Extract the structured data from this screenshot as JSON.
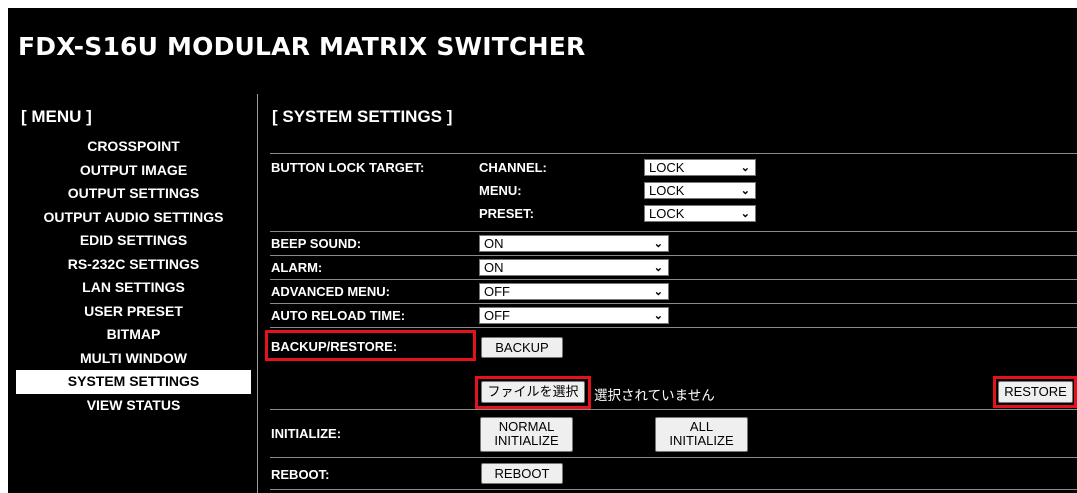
{
  "app": {
    "title": "FDX-S16U MODULAR MATRIX SWITCHER"
  },
  "menu": {
    "heading": "[ MENU ]",
    "items": [
      {
        "label": "CROSSPOINT"
      },
      {
        "label": "OUTPUT IMAGE"
      },
      {
        "label": "OUTPUT SETTINGS"
      },
      {
        "label": "OUTPUT AUDIO SETTINGS"
      },
      {
        "label": "EDID SETTINGS"
      },
      {
        "label": "RS-232C SETTINGS"
      },
      {
        "label": "LAN SETTINGS"
      },
      {
        "label": "USER PRESET"
      },
      {
        "label": "BITMAP"
      },
      {
        "label": "MULTI WINDOW"
      },
      {
        "label": "SYSTEM SETTINGS",
        "active": true
      },
      {
        "label": "VIEW STATUS"
      }
    ]
  },
  "main": {
    "heading": "[ SYSTEM SETTINGS ]",
    "button_lock": {
      "label": "BUTTON LOCK TARGET:",
      "channel_label": "CHANNEL:",
      "channel_value": "LOCK",
      "menu_label": "MENU:",
      "menu_value": "LOCK",
      "preset_label": "PRESET:",
      "preset_value": "LOCK"
    },
    "beep_sound": {
      "label": "BEEP SOUND:",
      "value": "ON"
    },
    "alarm": {
      "label": "ALARM:",
      "value": "ON"
    },
    "advanced_menu": {
      "label": "ADVANCED MENU:",
      "value": "OFF"
    },
    "auto_reload_time": {
      "label": "AUTO RELOAD TIME:",
      "value": "OFF"
    },
    "backup_restore": {
      "label": "BACKUP/RESTORE:",
      "backup_button": "BACKUP",
      "file_button": "ファイルを選択",
      "file_status": "選択されていません",
      "restore_button": "RESTORE"
    },
    "initialize": {
      "label": "INITIALIZE:",
      "normal_line1": "NORMAL",
      "normal_line2": "INITIALIZE",
      "all_line1": "ALL",
      "all_line2": "INITIALIZE"
    },
    "reboot": {
      "label": "REBOOT:",
      "button": "REBOOT"
    }
  },
  "colors": {
    "background": "#000000",
    "text": "#ffffff",
    "highlight": "#e3121b",
    "active_menu_bg": "#ffffff"
  },
  "icons": {
    "dropdown": "chevron-down-icon"
  }
}
